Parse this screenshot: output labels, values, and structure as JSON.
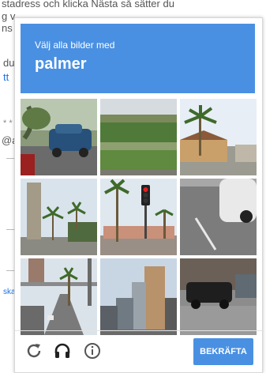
{
  "background": {
    "line1": "stadress och klicka Nästa så sätter du",
    "line2": "g v",
    "line3": "ns",
    "du": "du",
    "link": "tt",
    "star": "* *",
    "at": "@a",
    "ska": "ska"
  },
  "captcha": {
    "instruction": "Välj alla bilder med",
    "target": "palmer",
    "tiles": [
      {
        "scene": "street-car-blue"
      },
      {
        "scene": "field"
      },
      {
        "scene": "palm-house"
      },
      {
        "scene": "palm-street"
      },
      {
        "scene": "palm-traffic-light"
      },
      {
        "scene": "road-car"
      },
      {
        "scene": "highway-bridge"
      },
      {
        "scene": "city-buildings"
      },
      {
        "scene": "car-street"
      }
    ],
    "footer": {
      "reload_icon": "reload-icon",
      "audio_icon": "headphones-icon",
      "info_icon": "info-icon",
      "verify_label": "BEKRÄFTA"
    }
  },
  "colors": {
    "accent": "#4a90e2"
  }
}
